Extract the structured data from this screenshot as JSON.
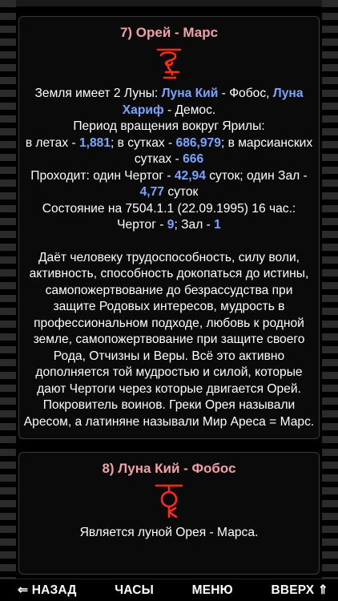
{
  "sections": [
    {
      "title": "7) Орей - Марс",
      "symbol_icon": "orey-rune-icon",
      "description": [
        {
          "text": "Земля имеет 2 Луны: "
        },
        {
          "text": "Луна Кий",
          "hl": true
        },
        {
          "text": " - Фобос, "
        },
        {
          "text": "Луна Хариф",
          "hl": true
        },
        {
          "text": " - Демос."
        },
        {
          "br": true
        },
        {
          "text": "Период вращения вокруг Ярилы:"
        },
        {
          "br": true
        },
        {
          "text": "в летах - "
        },
        {
          "text": "1,881",
          "hl": true
        },
        {
          "text": "; в сутках - "
        },
        {
          "text": "686,979",
          "hl": true
        },
        {
          "text": "; в марсианских сутках - "
        },
        {
          "text": "666",
          "hl": true
        },
        {
          "br": true
        },
        {
          "text": "Проходит: один Чертог - "
        },
        {
          "text": "42,94",
          "hl": true
        },
        {
          "text": " суток; один Зал - "
        },
        {
          "text": "4,77",
          "hl": true
        },
        {
          "text": " суток"
        },
        {
          "br": true
        },
        {
          "text": "Состояние на 7504.1.1 (22.09.1995) 16 час.: Чертог - "
        },
        {
          "text": "9",
          "hl": true
        },
        {
          "text": "; Зал - "
        },
        {
          "text": "1",
          "hl": true
        }
      ],
      "body": "Даёт человеку трудоспособность, силу воли, активность, способность докопаться до истины, самопожертвование до безрассудства при защите Родовых интересов, мудрость в профессиональном подходе, любовь к родной земле, самопожертвование при защите своего Рода, Отчизны и Веры. Всё это активно дополняется той мудростью и силой, которые дают Чертоги через которые двигается Орей. Покровитель воинов. Греки Орея называли Аресом, а латиняне называли Мир Ареса = Марс."
    },
    {
      "title": "8) Луна Кий - Фобос",
      "symbol_icon": "luna-kiy-rune-icon",
      "body": "Является луной Орея - Марса."
    }
  ],
  "bottom_nav": {
    "back": "⇐ НАЗАД",
    "clock": "ЧАСЫ",
    "menu": "МЕНЮ",
    "up": "ВВЕРХ ⇑"
  },
  "colors": {
    "title": "#f2a0a6",
    "highlight": "#78a6ff",
    "symbol": "#ff2a1a",
    "background": "#000000",
    "text": "#ffffff"
  }
}
